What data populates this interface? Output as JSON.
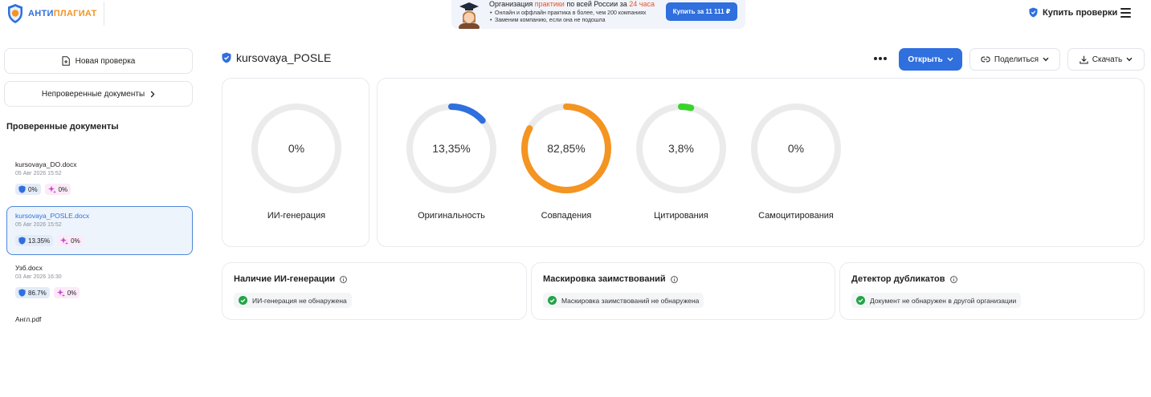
{
  "header": {
    "logo": {
      "part1": "АНТИ",
      "part2": "ПЛАГИАТ"
    },
    "promo": {
      "title_prefix": "Организация ",
      "title_highlight1": "практики",
      "title_middle": " по всей России за ",
      "title_highlight2": "24 часа",
      "line1": "Онлайн и оффлайн практика в более, чем 200 компаниях",
      "line2": "Заменим компанию, если она не подошла",
      "button": "Купить за 11 111 ₽"
    },
    "buy_checks": "Купить проверки"
  },
  "sidebar": {
    "new_check": "Новая проверка",
    "unchecked_docs": "Непроверенные документы",
    "checked_heading": "Проверенные документы",
    "docs": [
      {
        "name": "kursovaya_DO.docx",
        "date": "05 Авг 2026 15:52",
        "orig": "0%",
        "ai": "0%",
        "active": false
      },
      {
        "name": "kursovaya_POSLE.docx",
        "date": "05 Авг 2026 15:52",
        "orig": "13.35%",
        "ai": "0%",
        "active": true
      },
      {
        "name": "Узб.docx",
        "date": "03 Авг 2026 16:30",
        "orig": "86.7%",
        "ai": "0%",
        "active": false
      },
      {
        "name": "Англ.pdf",
        "date": "",
        "orig": "",
        "ai": "",
        "active": false
      }
    ]
  },
  "main": {
    "doc_title": "kursovaya_POSLE",
    "open_button": "Открыть",
    "share_button": "Поделиться",
    "download_button": "Скачать",
    "ai_gauge": {
      "value": "0%",
      "label": "ИИ-генерация",
      "fraction": 0,
      "color": "#2f6fde"
    },
    "gauges": [
      {
        "value": "13,35%",
        "label": "Оригинальность",
        "fraction": 0.1335,
        "color": "#2f6fde"
      },
      {
        "value": "82,85%",
        "label": "Совпадения",
        "fraction": 0.8285,
        "color": "#f49421"
      },
      {
        "value": "3,8%",
        "label": "Цитирования",
        "fraction": 0.038,
        "color": "#3ad32c"
      },
      {
        "value": "0%",
        "label": "Самоцитирования",
        "fraction": 0,
        "color": "#2f6fde"
      }
    ],
    "info_cards": [
      {
        "title": "Наличие ИИ-генерации",
        "status": "ИИ-генерация не обнаружена"
      },
      {
        "title": "Маскировка заимствований",
        "status": "Маскировка заимствований не обнаружена"
      },
      {
        "title": "Детектор дубликатов",
        "status": "Документ не обнаружен в другой организации"
      }
    ]
  },
  "colors": {
    "brand_blue": "#2f6fde",
    "brand_orange": "#f49421",
    "citation_green": "#3ad32c",
    "track_gray": "#ebebeb",
    "success_green": "#22a447"
  }
}
